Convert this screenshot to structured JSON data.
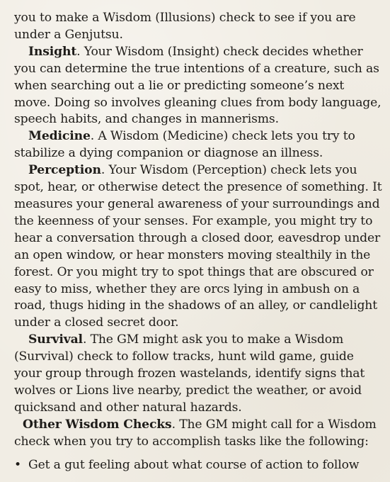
{
  "intro_continuation": "you to make a Wisdom (Illusions) check to see if you are under a Genjutsu.",
  "skills": [
    {
      "term": "Insight",
      "text": ". Your Wisdom (Insight) check decides whether you can determine the true intentions of a creature, such as when searching out a lie or predicting someone’s next move. Doing so involves gleaning clues from body language, speech habits, and changes in mannerisms."
    },
    {
      "term": "Medicine",
      "text": ". A Wisdom (Medicine) check lets you try to stabilize a dying companion or diagnose an illness."
    },
    {
      "term": "Perception",
      "text": ".  Your Wisdom (Perception) check lets you spot, hear, or otherwise detect the presence of something. It measures your general awareness of your surroundings and the keenness of your senses. For example, you might try to hear a conversation through a closed door, eavesdrop under an open window, or hear monsters moving stealthily in the forest. Or you might try to spot things that are obscured or easy to miss, whether they are orcs lying in ambush on a road, thugs hiding in the shadows of an alley, or candlelight under a closed secret door."
    },
    {
      "term": "Survival",
      "text": ". The GM might ask you to make a Wisdom (Survival) check to follow tracks, hunt wild game, guide your group through frozen wastelands, identify signs that wolves or Lions live nearby, predict the weather, or avoid quicksand and other natural hazards."
    }
  ],
  "other_checks": {
    "term": "Other Wisdom Checks",
    "text": ". The GM might call for a Wisdom check when you try to accomplish tasks like the following:"
  },
  "bullets": [
    {
      "marker": "•",
      "text": "Get a gut feeling about what course of action to follow"
    }
  ]
}
